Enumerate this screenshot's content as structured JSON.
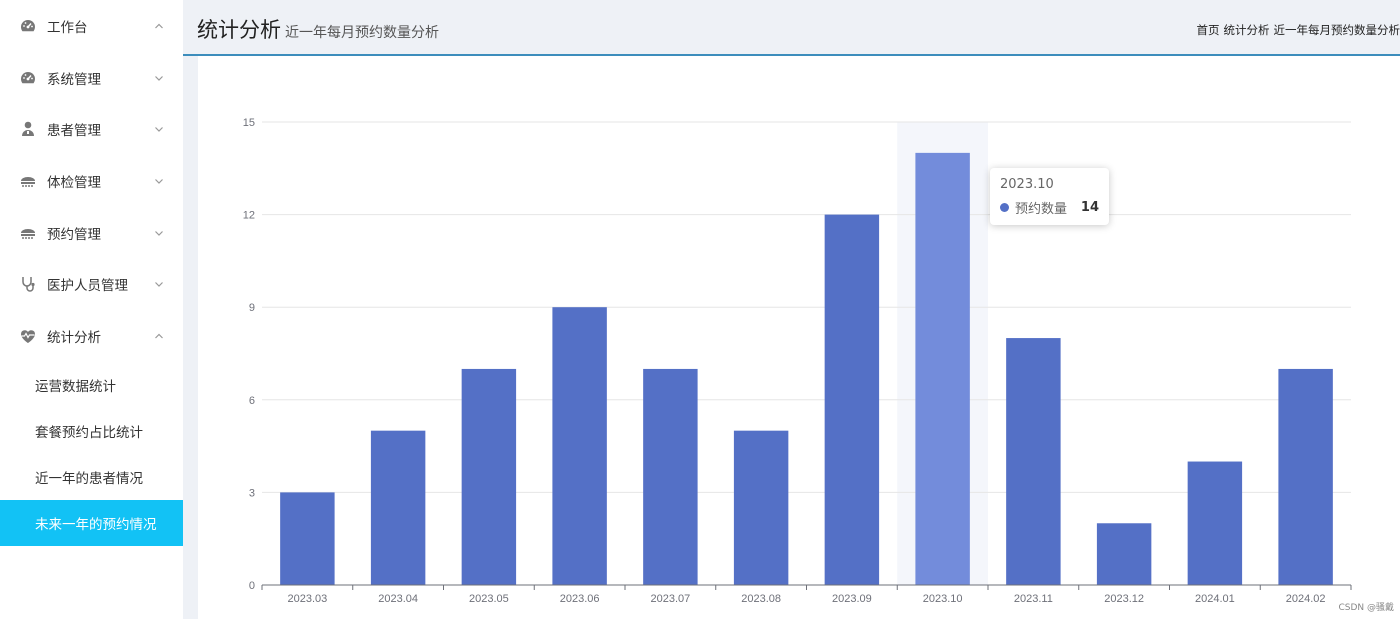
{
  "sidebar": {
    "items": [
      {
        "label": "工作台",
        "icon": "dashboard-icon",
        "arrow": "up"
      },
      {
        "label": "系统管理",
        "icon": "dashboard-icon",
        "arrow": "down"
      },
      {
        "label": "患者管理",
        "icon": "user-doctor-icon",
        "arrow": "down"
      },
      {
        "label": "体检管理",
        "icon": "stethoscope-device-icon",
        "arrow": "down"
      },
      {
        "label": "预约管理",
        "icon": "stethoscope-device-icon",
        "arrow": "down"
      },
      {
        "label": "医护人员管理",
        "icon": "stethoscope-icon",
        "arrow": "down"
      },
      {
        "label": "统计分析",
        "icon": "heartbeat-icon",
        "arrow": "up"
      }
    ],
    "sub_items": [
      {
        "label": "运营数据统计"
      },
      {
        "label": "套餐预约占比统计"
      },
      {
        "label": "近一年的患者情况"
      },
      {
        "label": "未来一年的预约情况",
        "active": true
      }
    ]
  },
  "header": {
    "title": "统计分析",
    "subtitle": "近一年每月预约数量分析",
    "breadcrumb": [
      "首页",
      "统计分析",
      "近一年每月预约数量分析"
    ]
  },
  "tooltip": {
    "title": "2023.10",
    "series_name": "预约数量",
    "value": "14"
  },
  "watermark": "CSDN @骚戴",
  "colors": {
    "bar": "#5470c6",
    "bar_highlight": "#738cdb",
    "active_menu": "#12c2f5",
    "header_border": "#3c8dbc"
  },
  "chart_data": {
    "type": "bar",
    "categories": [
      "2023.03",
      "2023.04",
      "2023.05",
      "2023.06",
      "2023.07",
      "2023.08",
      "2023.09",
      "2023.10",
      "2023.11",
      "2023.12",
      "2024.01",
      "2024.02"
    ],
    "series": [
      {
        "name": "预约数量",
        "values": [
          3,
          5,
          7,
          9,
          7,
          5,
          12,
          14,
          8,
          2,
          4,
          7
        ]
      }
    ],
    "yticks": [
      0,
      3,
      6,
      9,
      12,
      15
    ],
    "ylim": [
      0,
      15
    ],
    "grid": true,
    "highlighted_category": "2023.10"
  }
}
